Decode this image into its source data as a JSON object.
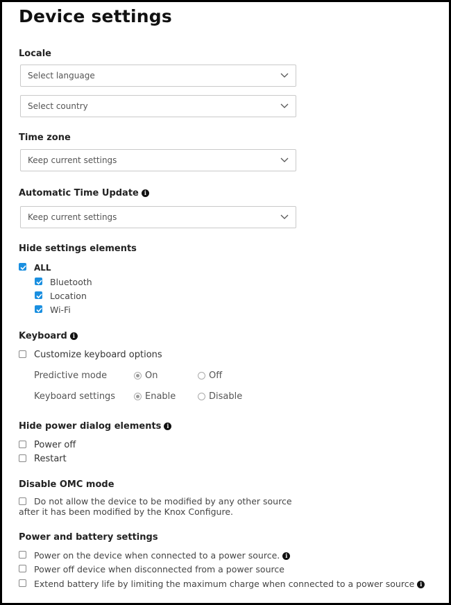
{
  "page": {
    "title": "Device settings"
  },
  "locale": {
    "heading": "Locale",
    "language": {
      "value": "Select language"
    },
    "country": {
      "value": "Select country"
    }
  },
  "timezone": {
    "heading": "Time zone",
    "value": "Keep current settings"
  },
  "auto_time": {
    "heading": "Automatic Time Update",
    "info_icon": "info-icon",
    "value": "Keep current settings"
  },
  "hide_settings": {
    "heading": "Hide settings elements",
    "all_label": "ALL",
    "all_checked": true,
    "items": [
      {
        "label": "Bluetooth",
        "checked": true
      },
      {
        "label": "Location",
        "checked": true
      },
      {
        "label": "Wi-Fi",
        "checked": true
      }
    ]
  },
  "keyboard": {
    "heading": "Keyboard",
    "customize_label": "Customize keyboard options",
    "customize_checked": false,
    "predictive": {
      "label": "Predictive mode",
      "on": "On",
      "off": "Off",
      "selected": "On"
    },
    "settings": {
      "label": "Keyboard settings",
      "enable": "Enable",
      "disable": "Disable",
      "selected": "Enable"
    }
  },
  "power_dialog": {
    "heading": "Hide power dialog elements",
    "items": [
      {
        "label": "Power off",
        "checked": false
      },
      {
        "label": "Restart",
        "checked": false
      }
    ]
  },
  "omc": {
    "heading": "Disable OMC mode",
    "line1": "Do not allow the device to be modified by any other source",
    "line2": "after it has been modified by the Knox Configure.",
    "checked": false
  },
  "power_battery": {
    "heading": "Power and battery settings",
    "items": [
      {
        "label": "Power on the device when connected to a power source.",
        "checked": false
      },
      {
        "label": "Power off device when disconnected from a power source",
        "checked": false
      },
      {
        "label": "Extend battery life by limiting the maximum charge when connected to a power source",
        "checked": false
      }
    ]
  },
  "colors": {
    "accent": "#1a8fe0",
    "border": "#c9c9c9"
  }
}
